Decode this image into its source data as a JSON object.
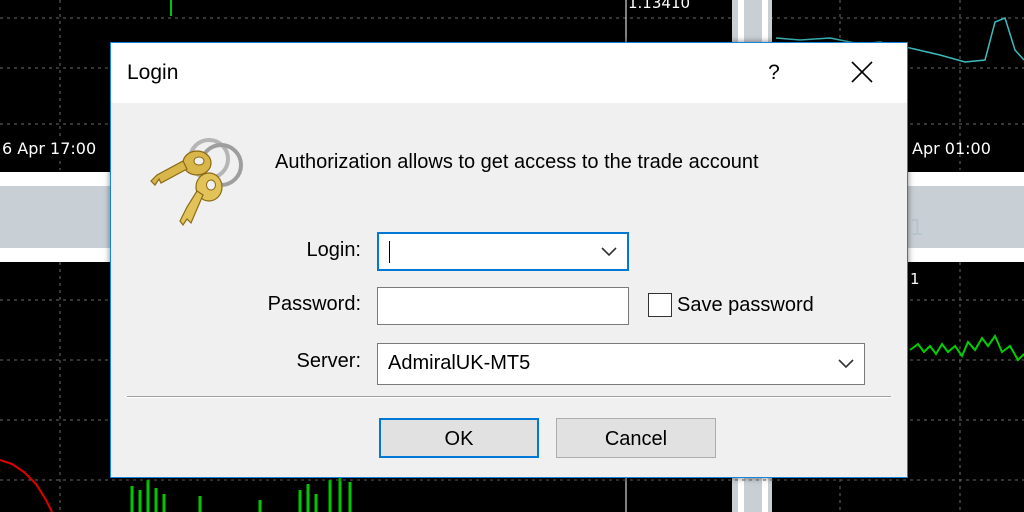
{
  "background": {
    "time_left": "6 Apr 17:00",
    "time_right": "Apr 01:00",
    "price_label": "1.13410",
    "tab_digit": "1",
    "subpanel_label": "1"
  },
  "dialog": {
    "title": "Login",
    "help_label": "?",
    "close_icon": "close-icon",
    "keys_icon": "keys-icon",
    "message": "Authorization allows to get access to the trade account",
    "login": {
      "label": "Login:",
      "value": ""
    },
    "password": {
      "label": "Password:",
      "value": ""
    },
    "save_password": {
      "label": "Save password",
      "checked": false
    },
    "server": {
      "label": "Server:",
      "value": "AdmiralUK-MT5"
    },
    "ok_label": "OK",
    "cancel_label": "Cancel"
  },
  "colors": {
    "accent": "#0078d7",
    "dialog_bg": "#f0f0f0",
    "chart_bg": "#000000",
    "key_gold": "#d9b64a"
  }
}
